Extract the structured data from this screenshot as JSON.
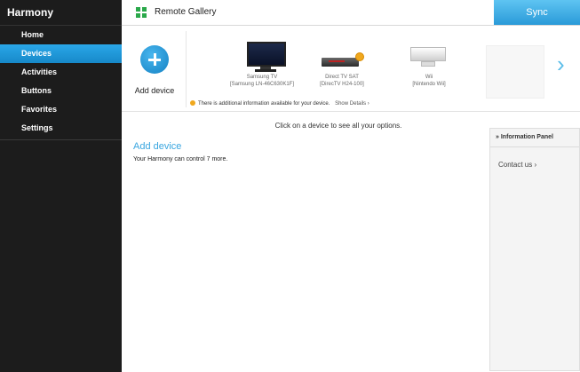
{
  "app": {
    "title": "Harmony"
  },
  "sidebar": {
    "items": [
      {
        "label": "Home",
        "active": false
      },
      {
        "label": "Devices",
        "active": true
      },
      {
        "label": "Activities",
        "active": false
      },
      {
        "label": "Buttons",
        "active": false
      },
      {
        "label": "Favorites",
        "active": false
      },
      {
        "label": "Settings",
        "active": false
      }
    ]
  },
  "header": {
    "title": "Remote Gallery",
    "sync_label": "Sync",
    "icon": "grid-icon"
  },
  "gallery": {
    "add_device_label": "Add device",
    "devices": [
      {
        "name": "Samsung TV",
        "model": "[Samsung LN-46C630K1F]",
        "icon": "tv-icon"
      },
      {
        "name": "Direct TV SAT",
        "model": "[DirecTV H24-100]",
        "icon": "satellite-box-icon",
        "warning": true
      },
      {
        "name": "Wii",
        "model": "[Nintendo Wii]",
        "icon": "wii-console-icon"
      }
    ],
    "info_message": "There is additional information available for your device.",
    "show_details_label": "Show Details",
    "next_icon": "chevron-right-icon"
  },
  "main": {
    "hint": "Click on a device to see all your options.",
    "add_device_link": "Add device",
    "capacity_text": "Your Harmony can control 7 more."
  },
  "info_panel": {
    "title": "Information Panel",
    "contact_label": "Contact us"
  },
  "colors": {
    "accent": "#2aa7e8",
    "sidebar_bg": "#1c1c1c",
    "warning": "#f0a81e"
  }
}
